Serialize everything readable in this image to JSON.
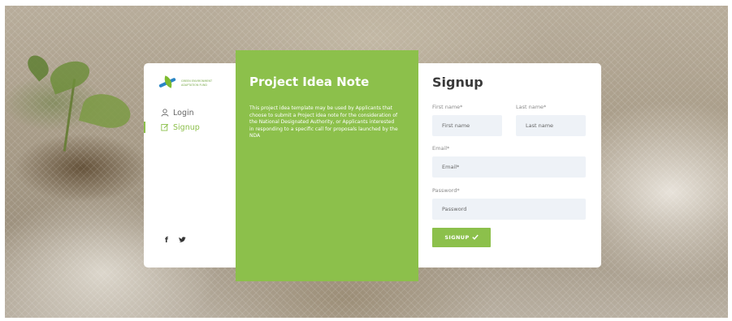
{
  "sidebar": {
    "logo_lines": [
      "GREEN ENVIRONMENT",
      "ADAPTATION FUND"
    ],
    "items": [
      {
        "label": "Login",
        "icon": "user-icon",
        "active": false
      },
      {
        "label": "Signup",
        "icon": "edit-icon",
        "active": true
      }
    ],
    "social": [
      "facebook-icon",
      "twitter-icon"
    ]
  },
  "info": {
    "title": "Project Idea Note",
    "description": "This project idea template may be used by Applicants that choose to submit a Project idea note for the consideration of the National Designated Authority, or Applicants interested in responding to a specific call for proposals launched by the NDA"
  },
  "form": {
    "title": "Signup",
    "first_name": {
      "label": "First name*",
      "placeholder": "First name",
      "value": ""
    },
    "last_name": {
      "label": "Last name*",
      "placeholder": "Last name",
      "value": ""
    },
    "email": {
      "label": "Email*",
      "placeholder": "Email*",
      "value": ""
    },
    "password": {
      "label": "Password*",
      "placeholder": "Password",
      "value": ""
    },
    "submit_label": "SIGNUP",
    "submit_icon": "check-icon"
  },
  "colors": {
    "accent": "#8cc04b",
    "input_bg": "#eef2f7",
    "logo_blue": "#2b86c5"
  }
}
